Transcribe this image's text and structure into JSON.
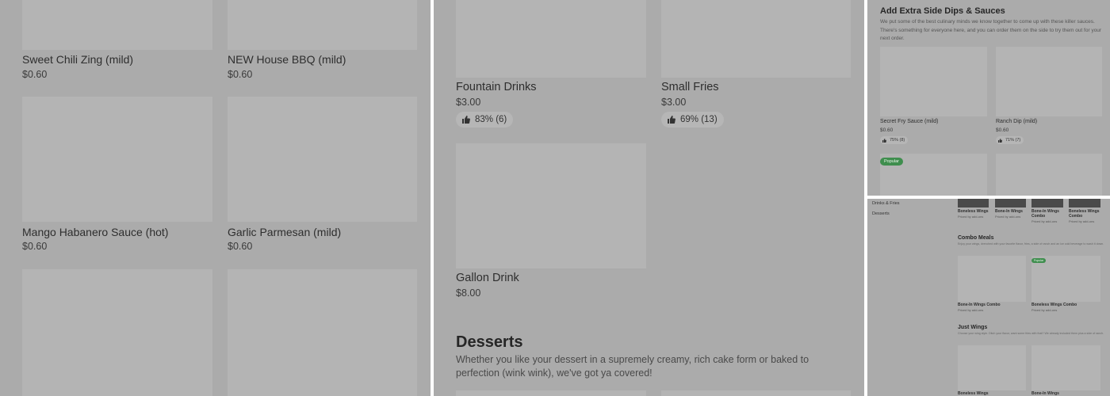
{
  "panel1": {
    "items": [
      {
        "name": "Sweet Chili Zing (mild)",
        "price": "$0.60"
      },
      {
        "name": "NEW House BBQ (mild)",
        "price": "$0.60"
      },
      {
        "name": "Mango Habanero Sauce (hot)",
        "price": "$0.60"
      },
      {
        "name": "Garlic Parmesan (mild)",
        "price": "$0.60"
      }
    ]
  },
  "panel2": {
    "items": [
      {
        "name": "Fountain Drinks",
        "price": "$3.00",
        "rating": "83% (6)"
      },
      {
        "name": "Small Fries",
        "price": "$3.00",
        "rating": "69% (13)"
      },
      {
        "name": "Gallon Drink",
        "price": "$8.00"
      }
    ],
    "desserts": {
      "title": "Desserts",
      "description": "Whether you like your dessert in a supremely creamy, rich cake form or baked to perfection (wink wink), we've got ya covered!"
    }
  },
  "panel3": {
    "title": "Add Extra Side Dips & Sauces",
    "description": "We put some of the best culinary minds we know together to come up with these killer sauces. There's something for everyone here, and you can order them on the side to try them out for your next order.",
    "items": [
      {
        "name": "Secret Fry Sauce (mild)",
        "price": "$0.60",
        "rating": "75% (8)"
      },
      {
        "name": "Ranch Dip (mild)",
        "price": "$0.60",
        "rating": "71% (7)"
      }
    ],
    "badge": "Popular"
  },
  "panel4": {
    "nav": [
      "Drinks & Fries",
      "Desserts"
    ],
    "top_items": [
      {
        "name": "Boneless Wings",
        "price": "Priced by add-ons"
      },
      {
        "name": "Bone-In Wings",
        "price": "Priced by add-ons"
      },
      {
        "name": "Bone-In Wings Combo",
        "price": "Priced by add-ons"
      },
      {
        "name": "Boneless Wings Combo",
        "price": "Priced by add-ons"
      }
    ],
    "combo_meals": {
      "title": "Combo Meals",
      "description": "Enjoy your wings, drenched with your favorite flavor, fries, a side of ranch and an ice cold beverage to wash it down.",
      "badge": "Popular",
      "items": [
        {
          "name": "Bone-In Wings Combo",
          "price": "Priced by add-ons"
        },
        {
          "name": "Boneless Wings Combo",
          "price": "Priced by add-ons"
        }
      ]
    },
    "just_wings": {
      "title": "Just Wings",
      "description": "Choose your wing style. Ditch your flavor, want some fries with that? We already included them plus a side of ranch.",
      "items": [
        {
          "name": "Boneless Wings"
        },
        {
          "name": "Bone-In Wings"
        }
      ]
    }
  },
  "colors": {
    "overlay": "#ababab",
    "placeholder": "#b4b4b4",
    "badge_green": "#3f8e4e"
  },
  "icons": [
    "thumbs-up-icon"
  ]
}
